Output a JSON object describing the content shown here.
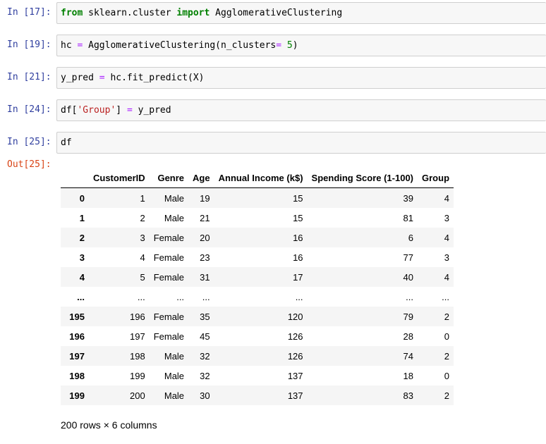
{
  "cells": [
    {
      "prompt": "In [17]:",
      "tokens": [
        [
          "kw",
          "from"
        ],
        [
          "",
          " sklearn.cluster "
        ],
        [
          "kw",
          "import"
        ],
        [
          "",
          " AgglomerativeClustering"
        ]
      ]
    },
    {
      "prompt": "In [19]:",
      "tokens": [
        [
          "",
          "hc "
        ],
        [
          "op",
          "="
        ],
        [
          "",
          " AgglomerativeClustering(n_clusters"
        ],
        [
          "op",
          "="
        ],
        [
          "",
          " "
        ],
        [
          "num",
          "5"
        ],
        [
          "",
          ")"
        ]
      ]
    },
    {
      "prompt": "In [21]:",
      "tokens": [
        [
          "",
          "y_pred "
        ],
        [
          "op",
          "="
        ],
        [
          "",
          " hc.fit_predict(X)"
        ]
      ]
    },
    {
      "prompt": "In [24]:",
      "tokens": [
        [
          "",
          "df["
        ],
        [
          "str",
          "'Group'"
        ],
        [
          "",
          "] "
        ],
        [
          "op",
          "="
        ],
        [
          "",
          " y_pred"
        ]
      ]
    },
    {
      "prompt": "In [25]:",
      "tokens": [
        [
          "",
          "df"
        ]
      ]
    }
  ],
  "output": {
    "prompt": "Out[25]:",
    "columns": [
      "",
      "CustomerID",
      "Genre",
      "Age",
      "Annual Income (k$)",
      "Spending Score (1-100)",
      "Group"
    ],
    "rows": [
      [
        "0",
        "1",
        "Male",
        "19",
        "15",
        "39",
        "4"
      ],
      [
        "1",
        "2",
        "Male",
        "21",
        "15",
        "81",
        "3"
      ],
      [
        "2",
        "3",
        "Female",
        "20",
        "16",
        "6",
        "4"
      ],
      [
        "3",
        "4",
        "Female",
        "23",
        "16",
        "77",
        "3"
      ],
      [
        "4",
        "5",
        "Female",
        "31",
        "17",
        "40",
        "4"
      ],
      [
        "...",
        "...",
        "...",
        "...",
        "...",
        "...",
        "..."
      ],
      [
        "195",
        "196",
        "Female",
        "35",
        "120",
        "79",
        "2"
      ],
      [
        "196",
        "197",
        "Female",
        "45",
        "126",
        "28",
        "0"
      ],
      [
        "197",
        "198",
        "Male",
        "32",
        "126",
        "74",
        "2"
      ],
      [
        "198",
        "199",
        "Male",
        "32",
        "137",
        "18",
        "0"
      ],
      [
        "199",
        "200",
        "Male",
        "30",
        "137",
        "83",
        "2"
      ]
    ],
    "footer": "200 rows × 6 columns"
  }
}
